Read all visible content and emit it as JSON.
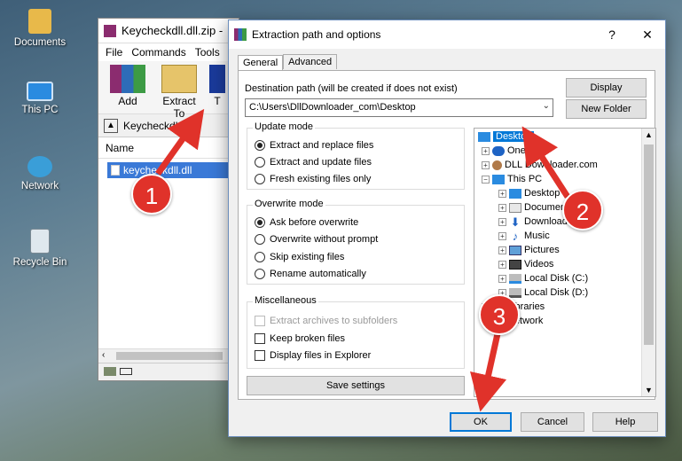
{
  "desktop": {
    "icons": [
      {
        "label": "Documents"
      },
      {
        "label": "This PC"
      },
      {
        "label": "Network"
      },
      {
        "label": "Recycle Bin"
      }
    ]
  },
  "winrar": {
    "title": "Keycheckdll.dll.zip -",
    "menu": [
      "File",
      "Commands",
      "Tools"
    ],
    "toolbar": {
      "add": "Add",
      "extract": "Extract To",
      "next": "T"
    },
    "address": "Keycheckdl",
    "column_name": "Name",
    "file": "keycheckdll.dll"
  },
  "dialog": {
    "title": "Extraction path and options",
    "help": "?",
    "close": "✕",
    "tabs": [
      "General",
      "Advanced"
    ],
    "dest_label": "Destination path (will be created if does not exist)",
    "dest_value": "C:\\Users\\DllDownloader_com\\Desktop",
    "display_btn": "Display",
    "newfolder_btn": "New Folder",
    "update_mode": {
      "title": "Update mode",
      "options": [
        "Extract and replace files",
        "Extract and update files",
        "Fresh existing files only"
      ],
      "selected": 0
    },
    "overwrite_mode": {
      "title": "Overwrite mode",
      "options": [
        "Ask before overwrite",
        "Overwrite without prompt",
        "Skip existing files",
        "Rename automatically"
      ],
      "selected": 0
    },
    "misc": {
      "title": "Miscellaneous",
      "options": [
        "Extract archives to subfolders",
        "Keep broken files",
        "Display files in Explorer"
      ]
    },
    "save_settings": "Save settings",
    "tree": [
      "Desktop",
      "OneDrive",
      "DLL Downloader.com",
      "This PC",
      "Desktop",
      "Documents",
      "Downloads",
      "Music",
      "Pictures",
      "Videos",
      "Local Disk (C:)",
      "Local Disk (D:)",
      "Libraries",
      "Network"
    ],
    "ok": "OK",
    "cancel": "Cancel",
    "help_btn": "Help"
  },
  "annotations": [
    "1",
    "2",
    "3"
  ],
  "colors": {
    "badge": "#e0322a",
    "selection": "#0078d7"
  }
}
